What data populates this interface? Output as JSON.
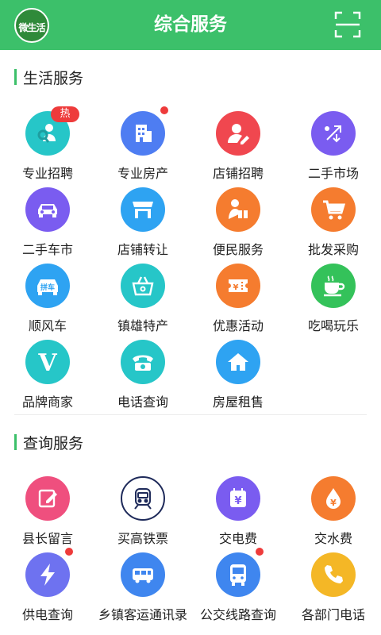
{
  "header": {
    "logo_text": "微生活",
    "title": "综合服务",
    "scan_icon": "scan-icon"
  },
  "life": {
    "title": "生活服务",
    "items": [
      {
        "label": "专业招聘",
        "icon": "recruit-icon",
        "color": "#26c6c8",
        "badge": "热"
      },
      {
        "label": "专业房产",
        "icon": "building-icon",
        "color": "#4e7df2",
        "dot": true
      },
      {
        "label": "店铺招聘",
        "icon": "user-edit-icon",
        "color": "#f0474f"
      },
      {
        "label": "二手市场",
        "icon": "swap-icon",
        "color": "#7a5cf0"
      },
      {
        "label": "二手车市",
        "icon": "car-icon",
        "color": "#7a5cf0"
      },
      {
        "label": "店铺转让",
        "icon": "shop-icon",
        "color": "#2ea3f2"
      },
      {
        "label": "便民服务",
        "icon": "delivery-icon",
        "color": "#f57c2f"
      },
      {
        "label": "批发采购",
        "icon": "cart-icon",
        "color": "#f57c2f"
      },
      {
        "label": "顺风车",
        "icon": "carpool-icon",
        "color": "#2ea3f2",
        "icon_text": "拼车"
      },
      {
        "label": "镇雄特产",
        "icon": "basket-icon",
        "color": "#26c6c8"
      },
      {
        "label": "优惠活动",
        "icon": "ticket-icon",
        "color": "#f57c2f"
      },
      {
        "label": "吃喝玩乐",
        "icon": "coffee-icon",
        "color": "#34c25a"
      },
      {
        "label": "品牌商家",
        "icon": "brand-v-icon",
        "color": "#26c6c8",
        "icon_text": "V"
      },
      {
        "label": "电话查询",
        "icon": "telephone-icon",
        "color": "#26c6c8"
      },
      {
        "label": "房屋租售",
        "icon": "home-icon",
        "color": "#2ea3f2"
      }
    ]
  },
  "query": {
    "title": "查询服务",
    "items": [
      {
        "label": "县长留言",
        "icon": "note-edit-icon",
        "color": "#ef4f7e"
      },
      {
        "label": "买高铁票",
        "icon": "train-icon",
        "color": "#ffffff"
      },
      {
        "label": "交电费",
        "icon": "electric-bill-icon",
        "color": "#7a5cf0",
        "icon_text": "¥"
      },
      {
        "label": "交水费",
        "icon": "water-bill-icon",
        "color": "#f57c2f",
        "icon_text": "¥"
      },
      {
        "label": "供电查询",
        "icon": "lightning-icon",
        "color": "#6e72f0",
        "dot": true
      },
      {
        "label": "乡镇客运通讯录",
        "icon": "bus-icon",
        "color": "#3f86ef"
      },
      {
        "label": "公交线路查询",
        "icon": "bus-front-icon",
        "color": "#3f86ef",
        "dot": true
      },
      {
        "label": "各部门电话",
        "icon": "phone-icon",
        "color": "#f4b726"
      }
    ]
  }
}
